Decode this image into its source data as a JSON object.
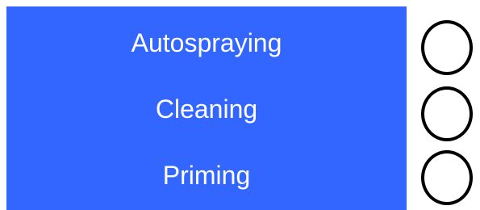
{
  "panel": {
    "background": "#3366ff",
    "text_color": "#ffffff"
  },
  "modes": [
    {
      "label": "Autospraying",
      "indicator": "circle-indicator-icon",
      "active": false
    },
    {
      "label": "Cleaning",
      "indicator": "circle-indicator-icon",
      "active": false
    },
    {
      "label": "Priming",
      "indicator": "circle-indicator-icon",
      "active": false
    }
  ]
}
